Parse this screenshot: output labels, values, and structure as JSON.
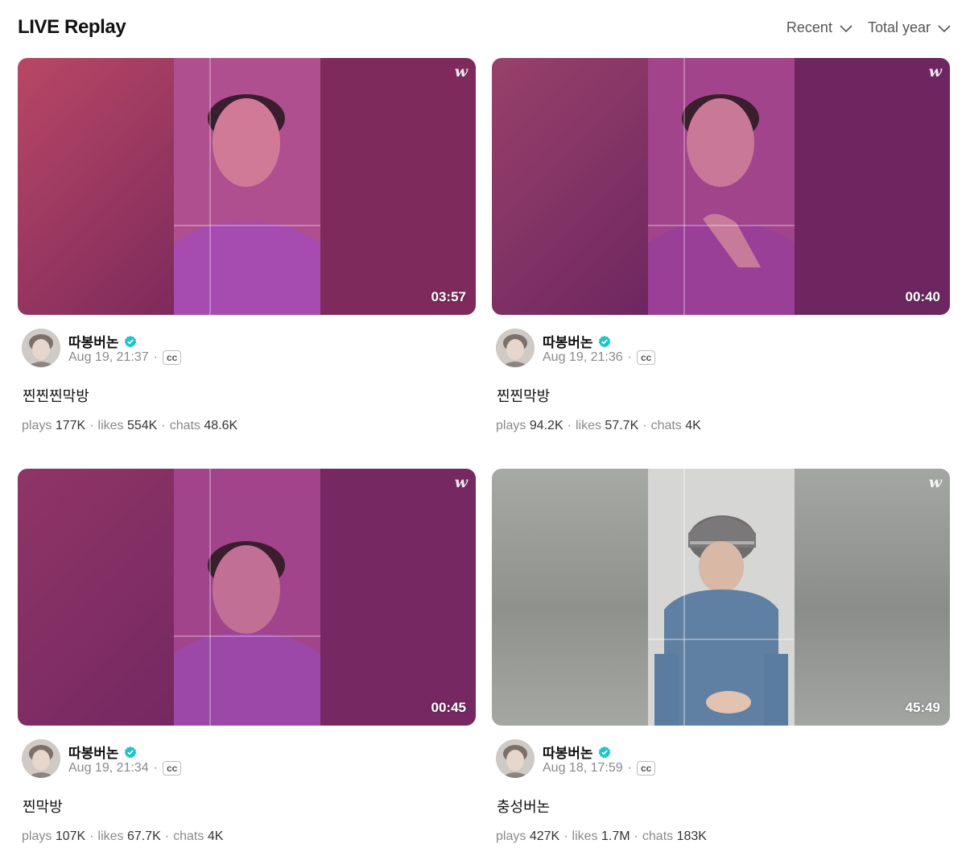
{
  "page": {
    "title": "LIVE Replay",
    "filters": [
      {
        "label": "Recent",
        "icon": "chevron-down-icon"
      },
      {
        "label": "Total year",
        "icon": "chevron-down-icon"
      }
    ]
  },
  "brand": {
    "logo_glyph": "w",
    "accent": "#1ec4c9"
  },
  "videos": [
    {
      "duration": "03:57",
      "channel": "따봉버논",
      "date": "Aug 19, 21:37",
      "cc": "cc",
      "title": "찐찐찐막방",
      "stats": {
        "plays_label": "plays",
        "plays": "177K",
        "likes_label": "likes",
        "likes": "554K",
        "chats_label": "chats",
        "chats": "48.6K"
      },
      "theme": {
        "left": "#b84765",
        "right": "#7e2a5c",
        "frame": "#9a3f7f"
      }
    },
    {
      "duration": "00:40",
      "channel": "따봉버논",
      "date": "Aug 19, 21:36",
      "cc": "cc",
      "title": "찐찐막방",
      "stats": {
        "plays_label": "plays",
        "plays": "94.2K",
        "likes_label": "likes",
        "likes": "57.7K",
        "chats_label": "chats",
        "chats": "4K"
      },
      "theme": {
        "left": "#98416a",
        "right": "#6e2660",
        "frame": "#9a3d85"
      }
    },
    {
      "duration": "00:45",
      "channel": "따봉버논",
      "date": "Aug 19, 21:34",
      "cc": "cc",
      "title": "찐막방",
      "stats": {
        "plays_label": "plays",
        "plays": "107K",
        "likes_label": "likes",
        "likes": "67.7K",
        "chats_label": "chats",
        "chats": "4K"
      },
      "theme": {
        "left": "#8f3566",
        "right": "#752862",
        "frame": "#963e86"
      }
    },
    {
      "duration": "45:49",
      "channel": "따봉버논",
      "date": "Aug 18, 17:59",
      "cc": "cc",
      "title": "충성버논",
      "stats": {
        "plays_label": "plays",
        "plays": "427K",
        "likes_label": "likes",
        "likes": "1.7M",
        "chats_label": "chats",
        "chats": "183K"
      },
      "theme": {
        "left": "#9a9c98",
        "right": "#94968f",
        "frame": "#c8c8c6"
      }
    }
  ]
}
